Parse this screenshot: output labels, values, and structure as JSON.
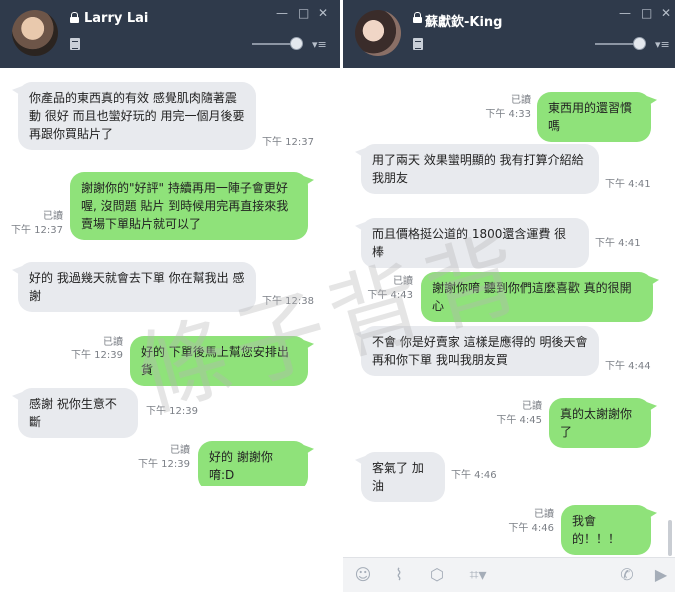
{
  "left_window": {
    "contact_name": "Larry Lai",
    "messages": [
      {
        "side": "recv",
        "text": "你產品的東西真的有效 感覺肌肉隨著震\n動 很好 而且也蠻好玩的 用完一個月後要\n再跟你買貼片了",
        "time": "下午 12:37"
      },
      {
        "side": "sent",
        "text": "謝謝你的\"好評\" 持續再用一陣子會更好\n喔, 沒問題 貼片 到時候用完再直接來我\n賣場下單貼片就可以了",
        "read": "已讀",
        "time": "下午 12:37"
      },
      {
        "side": "recv",
        "text": "好的 我過幾天就會去下單 你在幫我出 感\n謝",
        "time": "下午 12:38"
      },
      {
        "side": "sent",
        "text": "好的 下單後馬上幫您安排出貨",
        "read": "已讀",
        "time": "下午 12:39"
      },
      {
        "side": "recv",
        "text": "感謝 祝你生意不斷",
        "time": "下午 12:39"
      },
      {
        "side": "sent",
        "text": "好的 謝謝你唷:D",
        "read": "已讀",
        "time": "下午 12:39"
      }
    ]
  },
  "right_window": {
    "contact_name": "蘇獻欽-King",
    "messages": [
      {
        "side": "sent",
        "text": "東西用的還習慣嗎",
        "read": "已讀",
        "time": "下午 4:33"
      },
      {
        "side": "recv",
        "text": "用了兩天 效果蠻明顯的 我有打算介紹給\n我朋友",
        "time": "下午 4:41"
      },
      {
        "side": "recv",
        "text": "而且價格挺公道的 1800還含運費 很棒",
        "time": "下午 4:41"
      },
      {
        "side": "sent",
        "text": "謝謝你唷 聽到你們這麼喜歡 真的很開心",
        "read": "已讀",
        "time": "下午 4:43"
      },
      {
        "side": "recv",
        "text": "不會 你是好賣家 這樣是應得的 明後天會\n再和你下單 我叫我朋友買",
        "time": "下午 4:44"
      },
      {
        "side": "sent",
        "text": "真的太謝謝你了",
        "read": "已讀",
        "time": "下午 4:45"
      },
      {
        "side": "recv",
        "text": "客氣了 加油",
        "time": "下午 4:46"
      },
      {
        "side": "sent",
        "text": "我會的！！！",
        "read": "已讀",
        "time": "下午 4:46"
      }
    ]
  },
  "watermark": "條子背背",
  "icons": {
    "lock": "lock-icon",
    "note": "note-icon",
    "minimize": "minimize-icon",
    "maximize": "maximize-icon",
    "close": "close-icon",
    "emoji": "emoji-icon",
    "attach": "attach-icon",
    "sticker": "sticker-icon",
    "crop": "crop-icon",
    "call": "phone-icon",
    "video": "video-icon"
  },
  "glyphs": {
    "minimize": "—",
    "maximize": "□",
    "close": "✕",
    "menu": "▾≡",
    "emoji": "☺",
    "attach": "⌇",
    "sticker": "⬡",
    "crop": "⌗▾",
    "call": "✆",
    "video": "▶"
  }
}
